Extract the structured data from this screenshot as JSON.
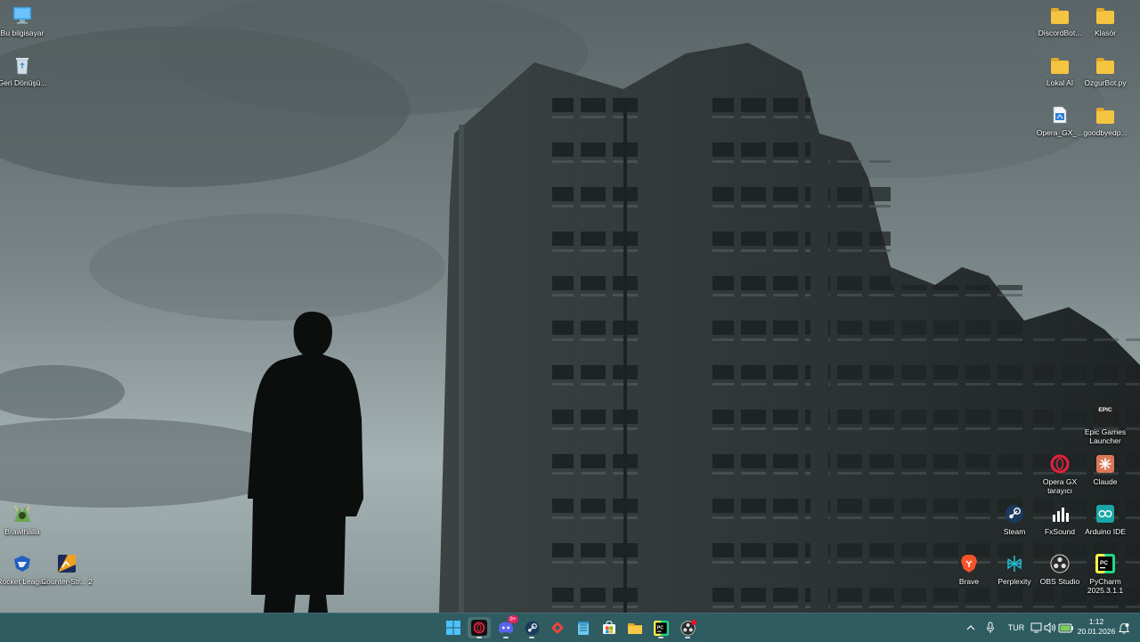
{
  "desktop": {
    "left_icons": [
      {
        "label": "Bu bilgisayar",
        "icon": "monitor-icon"
      },
      {
        "label": "Geri Dönüşü...",
        "icon": "recycle-bin-icon"
      },
      {
        "label": "Brawlhalla",
        "icon": "brawlhalla-icon"
      },
      {
        "label": "Rocket League",
        "icon": "rocket-league-icon"
      },
      {
        "label": "Counter-Str... 2",
        "icon": "counter-strike-icon"
      }
    ],
    "right_icons": [
      {
        "label": "DiscordBot...",
        "icon": "folder-icon"
      },
      {
        "label": "Klasör",
        "icon": "folder-icon"
      },
      {
        "label": "Lokal AI",
        "icon": "folder-icon"
      },
      {
        "label": "OzgurBot.py",
        "icon": "folder-icon"
      },
      {
        "label": "Opera_GX_...",
        "icon": "file-icon"
      },
      {
        "label": "goodbyedp...",
        "icon": "folder-icon"
      },
      {
        "label": "Epic Games Launcher",
        "icon": "epic-games-icon"
      },
      {
        "label": "Opera GX tarayıcı",
        "icon": "opera-gx-icon"
      },
      {
        "label": "Claude",
        "icon": "claude-icon"
      },
      {
        "label": "Steam",
        "icon": "steam-icon"
      },
      {
        "label": "FxSound",
        "icon": "fxsound-icon"
      },
      {
        "label": "Arduino IDE",
        "icon": "arduino-icon"
      },
      {
        "label": "Brave",
        "icon": "brave-icon"
      },
      {
        "label": "Perplexity",
        "icon": "perplexity-icon"
      },
      {
        "label": "OBS Studio",
        "icon": "obs-icon"
      },
      {
        "label": "PyCharm 2025.3.1.1",
        "icon": "pycharm-icon"
      }
    ],
    "epic_badge_text": "EPIC"
  },
  "taskbar": {
    "apps": [
      {
        "name": "start-button",
        "icon": "windows-icon"
      },
      {
        "name": "opera-gx",
        "icon": "opera-gx-icon"
      },
      {
        "name": "discord",
        "icon": "discord-icon",
        "badge": "9+"
      },
      {
        "name": "steam",
        "icon": "steam-icon"
      },
      {
        "name": "anydesk",
        "icon": "anydesk-icon"
      },
      {
        "name": "notepad",
        "icon": "notepad-icon"
      },
      {
        "name": "microsoft-store",
        "icon": "store-icon"
      },
      {
        "name": "file-explorer",
        "icon": "folder-icon"
      },
      {
        "name": "pycharm",
        "icon": "pycharm-icon"
      },
      {
        "name": "obs-studio",
        "icon": "obs-icon"
      }
    ],
    "tray": {
      "language": "TUR",
      "time": "1:12",
      "date": "20.01.2026"
    }
  },
  "colors": {
    "taskbar": "#2e5c60",
    "folder": "#f5c542",
    "discord_badge": "#e0245e"
  }
}
